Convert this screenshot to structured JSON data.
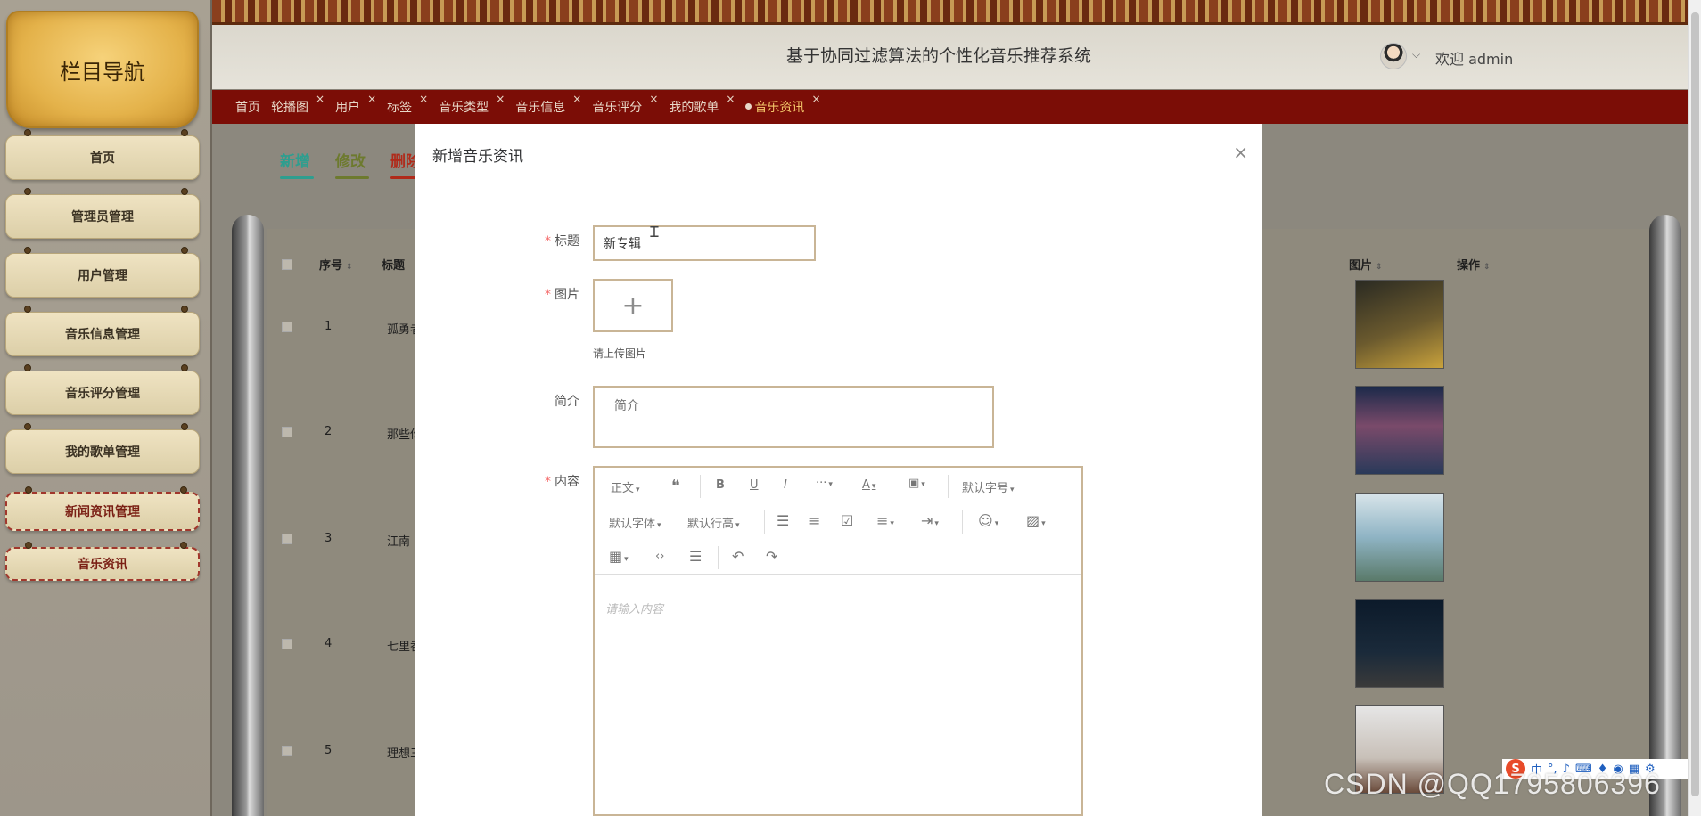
{
  "sidebar": {
    "title": "栏目导航",
    "items": [
      {
        "label": "首页"
      },
      {
        "label": "管理员管理"
      },
      {
        "label": "用户管理"
      },
      {
        "label": "音乐信息管理"
      },
      {
        "label": "音乐评分管理"
      },
      {
        "label": "我的歌单管理"
      },
      {
        "label": "新闻资讯管理"
      },
      {
        "label": "音乐资讯"
      }
    ]
  },
  "header": {
    "title": "基于协同过滤算法的个性化音乐推荐系统",
    "welcome": "欢迎 admin"
  },
  "tabs": [
    {
      "label": "首页"
    },
    {
      "label": "轮播图"
    },
    {
      "label": "用户"
    },
    {
      "label": "标签"
    },
    {
      "label": "音乐类型"
    },
    {
      "label": "音乐信息"
    },
    {
      "label": "音乐评分"
    },
    {
      "label": "我的歌单"
    },
    {
      "label": "音乐资讯"
    }
  ],
  "tab_close": "×",
  "toolbar": {
    "add": "新增",
    "edit": "修改",
    "delete": "删除"
  },
  "table": {
    "columns": {
      "index": "序号",
      "title": "标题",
      "image": "图片",
      "action": "操作"
    },
    "rows": [
      {
        "index": "1",
        "title": "孤勇者"
      },
      {
        "index": "2",
        "title": "那些你"
      },
      {
        "index": "3",
        "title": "江南"
      },
      {
        "index": "4",
        "title": "七里香"
      },
      {
        "index": "5",
        "title": "理想三"
      }
    ]
  },
  "modal": {
    "title": "新增音乐资讯",
    "close": "×",
    "fields": {
      "title_label": "标题",
      "title_value": "新专辑",
      "image_label": "图片",
      "image_hint": "请上传图片",
      "intro_label": "简介",
      "intro_placeholder": "简介",
      "content_label": "内容",
      "content_placeholder": "请输入内容"
    },
    "required_mark": "*",
    "editor_toolbar": {
      "paragraph": "正文",
      "font_size": "默认字号",
      "font_family": "默认字体",
      "line_height": "默认行高"
    }
  },
  "ime": {
    "mode": "中"
  },
  "watermark": "CSDN @QQ1795806396",
  "colors": {
    "tab_bar": "#7b0d06",
    "active_tab": "#f3c66a",
    "add_button": "#2e9e8f",
    "edit_button": "#6d7a2e",
    "delete_button": "#b02a1a",
    "field_border": "#c9b596",
    "required": "#f56c6c"
  }
}
